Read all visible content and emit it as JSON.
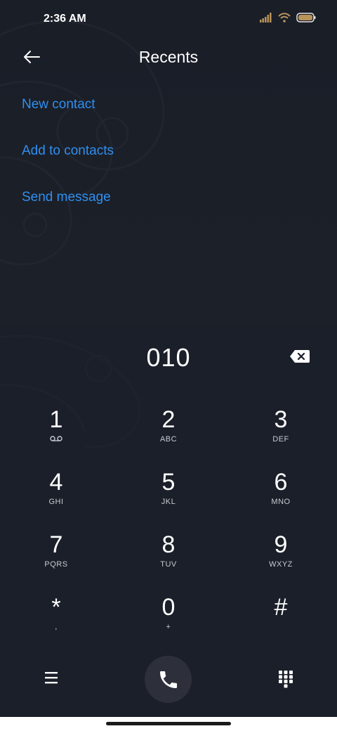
{
  "status_bar": {
    "time": "2:36 AM",
    "icons": [
      "signal-icon",
      "wifi-icon",
      "battery-icon"
    ]
  },
  "header": {
    "title": "Recents",
    "back_icon": "arrow-left-icon"
  },
  "actions": [
    {
      "label": "New contact"
    },
    {
      "label": "Add to contacts"
    },
    {
      "label": "Send message"
    }
  ],
  "dialer": {
    "number": "010",
    "backspace_icon": "backspace-icon",
    "keys": [
      {
        "digit": "1",
        "letters": "",
        "sub_icon": "voicemail-icon"
      },
      {
        "digit": "2",
        "letters": "ABC"
      },
      {
        "digit": "3",
        "letters": "DEF"
      },
      {
        "digit": "4",
        "letters": "GHI"
      },
      {
        "digit": "5",
        "letters": "JKL"
      },
      {
        "digit": "6",
        "letters": "MNO"
      },
      {
        "digit": "7",
        "letters": "PQRS"
      },
      {
        "digit": "8",
        "letters": "TUV"
      },
      {
        "digit": "9",
        "letters": "WXYZ"
      },
      {
        "digit": "*",
        "letters": ","
      },
      {
        "digit": "0",
        "letters": "+"
      },
      {
        "digit": "#",
        "letters": ""
      }
    ]
  },
  "bottom_bar": {
    "menu_icon": "menu-icon",
    "call_icon": "phone-icon",
    "keypad_icon": "dialpad-icon"
  },
  "colors": {
    "accent": "#2f8ff0",
    "background": "#171b24",
    "call_button": "#2d303a"
  }
}
